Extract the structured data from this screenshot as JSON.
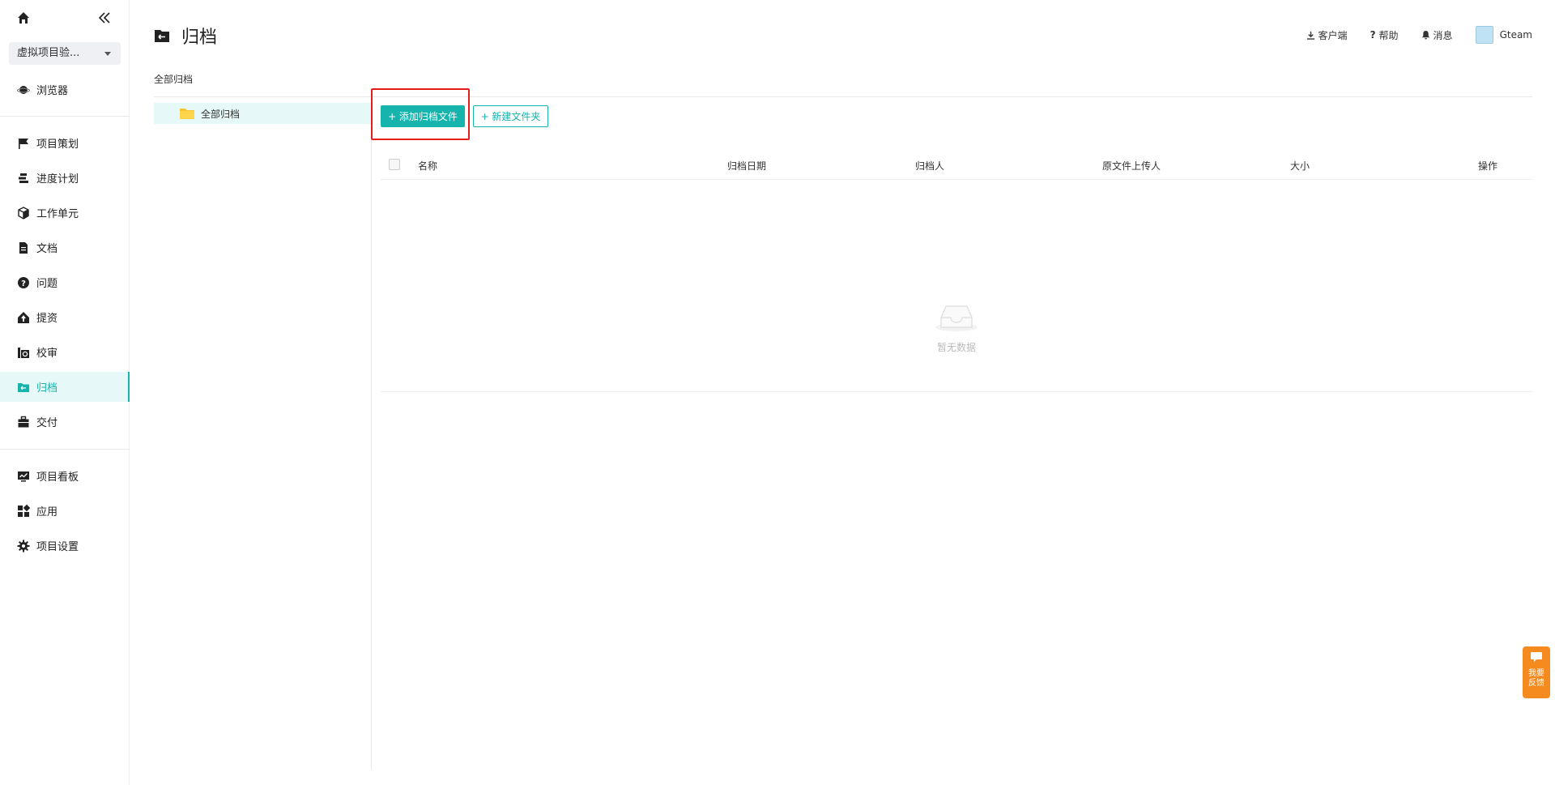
{
  "sidebar": {
    "icons": {
      "home": "home-icon",
      "collapse": "double-chevron-left-icon"
    },
    "project": {
      "selected": "虚拟项目验..."
    },
    "browser": {
      "label": "浏览器",
      "icon": "planet-icon"
    },
    "items": [
      {
        "label": "项目策划",
        "icon": "flag-icon"
      },
      {
        "label": "进度计划",
        "icon": "gantt-icon"
      },
      {
        "label": "工作单元",
        "icon": "cube-icon"
      },
      {
        "label": "文档",
        "icon": "document-icon"
      },
      {
        "label": "问题",
        "icon": "question-icon"
      },
      {
        "label": "提资",
        "icon": "upload-house-icon"
      },
      {
        "label": "校审",
        "icon": "review-icon"
      },
      {
        "label": "归档",
        "icon": "archive-icon",
        "active": true
      },
      {
        "label": "交付",
        "icon": "briefcase-icon"
      }
    ],
    "bottom": [
      {
        "label": "项目看板",
        "icon": "dashboard-icon"
      },
      {
        "label": "应用",
        "icon": "apps-icon"
      },
      {
        "label": "项目设置",
        "icon": "gear-icon"
      }
    ]
  },
  "header": {
    "title": "归档",
    "title_icon": "archive-icon",
    "client": "客户端",
    "help": "帮助",
    "messages": "消息",
    "user": "Gteam"
  },
  "breadcrumb": "全部归档",
  "tree": {
    "root": "全部归档"
  },
  "toolbar": {
    "add_archive": "+ 添加归档文件",
    "new_folder": "+ 新建文件夹"
  },
  "table": {
    "columns": [
      "名称",
      "归档日期",
      "归档人",
      "原文件上传人",
      "大小",
      "操作"
    ],
    "rows": [],
    "empty_text": "暂无数据"
  },
  "feedback": {
    "line1": "我要",
    "line2": "反馈"
  },
  "colors": {
    "accent": "#17b3ad",
    "highlight": "#e51c1c",
    "feedback": "#f58a1f"
  }
}
